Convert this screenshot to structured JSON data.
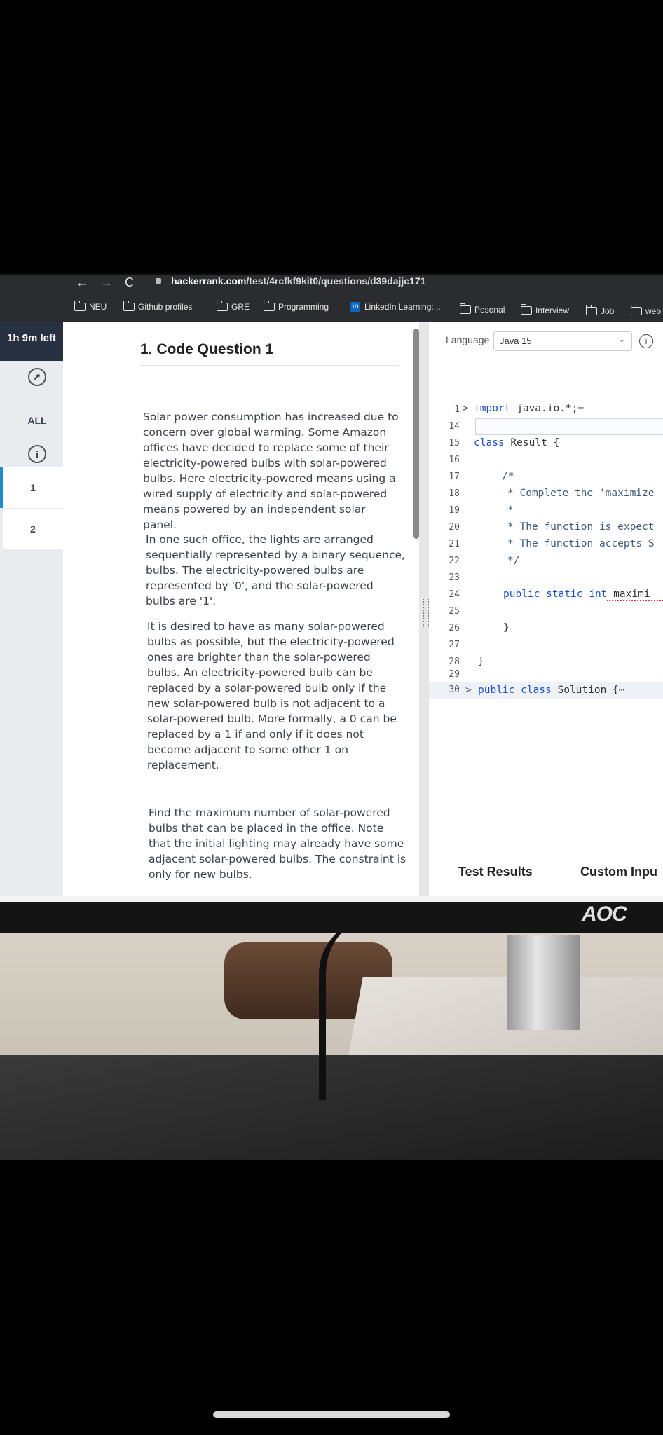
{
  "browser": {
    "url_prefix": "",
    "url_host": "hackerrank.com",
    "url_path": "/test/4rcfkf9kit0/questions/d39dajjc171",
    "nav_back": "←",
    "nav_forward": "→",
    "nav_reload": "C"
  },
  "bookmarks": [
    "NEU",
    "Github profiles",
    "GRE",
    "Programming",
    "LinkedIn Learning:...",
    "Pesonal",
    "Interview",
    "Job",
    "web"
  ],
  "rail": {
    "timer": "1h 9m left",
    "all_label": "ALL",
    "info_glyph": "i",
    "compass_glyph": "➚",
    "questions": [
      "1",
      "2"
    ]
  },
  "question": {
    "title": "1. Code Question 1",
    "paragraphs": {
      "p1": "Solar power consumption has increased due to concern over global warming. Some Amazon offices have decided to replace some of their electricity-powered bulbs with solar-powered bulbs. Here electricity-powered means using a wired supply of electricity and solar-powered means powered by an independent solar panel.",
      "p2": "In one such office, the lights are arranged sequentially represented by a binary sequence, bulbs. The electricity-powered bulbs are represented by '0', and the solar-powered bulbs are '1'.",
      "p3": "It is desired to have as many solar-powered bulbs as possible, but the electricity-powered ones are brighter than the solar-powered bulbs. An electricity-powered bulb can be replaced by a solar-powered bulb only if the new solar-powered bulb is not adjacent to a solar-powered bulb. More formally, a 0 can be replaced by a 1 if and only if it does not become adjacent to some other 1 on replacement.",
      "p4": "Find the maximum number of solar-powered bulbs that can be placed in the office. Note that the initial lighting may already have some adjacent solar-powered bulbs. The constraint is only for new bulbs."
    }
  },
  "editor": {
    "language_label": "Language",
    "language_value": "Java 15",
    "info_glyph": "i",
    "line_numbers": [
      "1",
      "14",
      "15",
      "16",
      "17",
      "18",
      "19",
      "20",
      "21",
      "22",
      "23",
      "24",
      "25",
      "26",
      "27",
      "28",
      "29",
      "30"
    ],
    "code": {
      "l1_kw": "import",
      "l1_rest": " java.io.*;",
      "l1_ellipsis": "⋯",
      "l15_kw": "class",
      "l15_rest": " Result {",
      "l17": "/*",
      "l18": "* Complete the 'maximize",
      "l19": "*",
      "l20": "* The function is expect",
      "l21": "* The function accepts S",
      "l22": "*/",
      "l24_kw": "public static int",
      "l24_rest": " maximi",
      "l26": "}",
      "l28": "}",
      "l30_kw": "public class",
      "l30_rest": " Solution {",
      "l30_ellipsis": "⋯"
    },
    "fold_glyph": ">",
    "tabs": {
      "test_results": "Test Results",
      "custom_input": "Custom Inpu"
    }
  },
  "monitor": {
    "brand": "AOC"
  }
}
